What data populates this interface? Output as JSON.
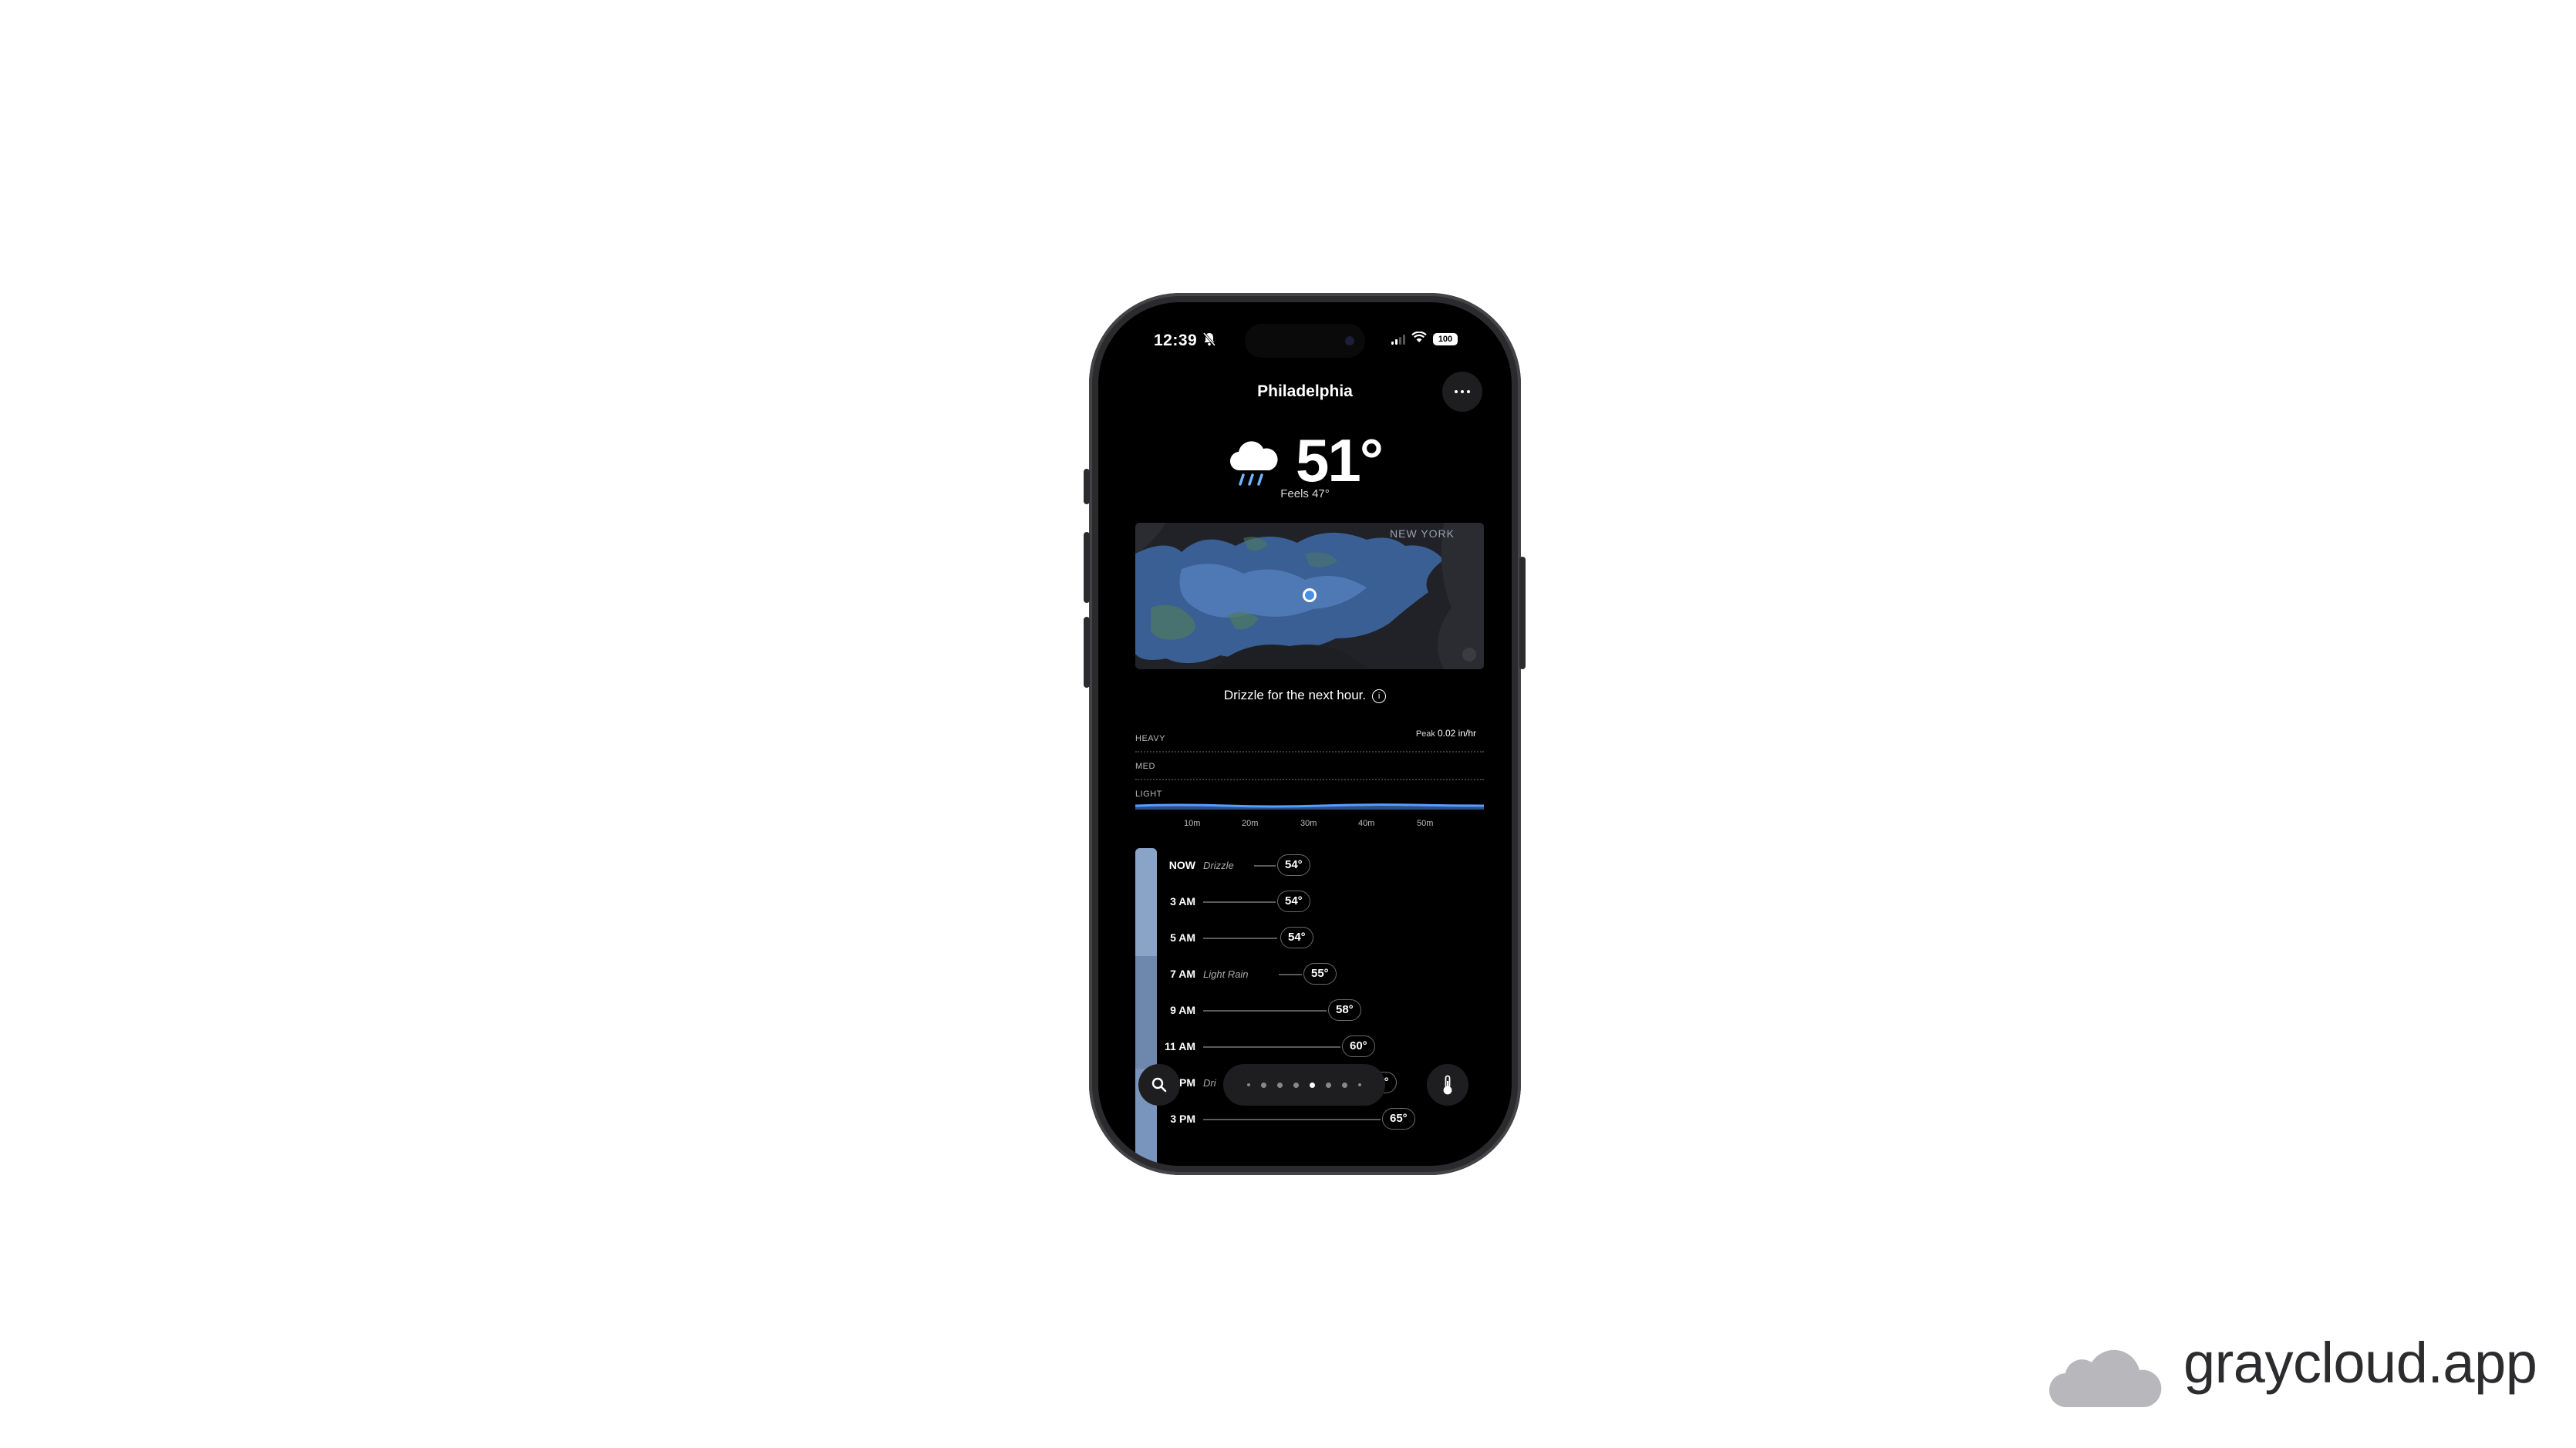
{
  "status_bar": {
    "time": "12:39",
    "battery": "100"
  },
  "header": {
    "city": "Philadelphia"
  },
  "current": {
    "temperature": "51°",
    "feels_like": "Feels 47°",
    "condition_icon": "cloud-rain-icon"
  },
  "map": {
    "label": "NEW YORK"
  },
  "precipitation": {
    "summary": "Drizzle for the next hour.",
    "peak_label": "Peak",
    "peak_value": "0.02 in/hr",
    "levels": [
      "HEAVY",
      "MED",
      "LIGHT"
    ],
    "minute_ticks": [
      "10m",
      "20m",
      "30m",
      "40m",
      "50m"
    ],
    "intensity_level": "light"
  },
  "hourly": [
    {
      "time": "NOW",
      "condition": "Drizzle",
      "temp": "54°"
    },
    {
      "time": "3 AM",
      "condition": "",
      "temp": "54°"
    },
    {
      "time": "5 AM",
      "condition": "",
      "temp": "54°"
    },
    {
      "time": "7 AM",
      "condition": "Light Rain",
      "temp": "55°"
    },
    {
      "time": "9 AM",
      "condition": "",
      "temp": "58°"
    },
    {
      "time": "11 AM",
      "condition": "",
      "temp": "60°"
    },
    {
      "time": "1 PM",
      "condition": "Dri",
      "temp": "63°"
    },
    {
      "time": "3 PM",
      "condition": "",
      "temp": "65°"
    }
  ],
  "page_indicator": {
    "count": 7,
    "active_index": 3
  },
  "colors": {
    "precip_bar": "#6d87ad",
    "radar": "#3f6aa8",
    "location_dot": "#4a90e2"
  },
  "brand": {
    "name": "graycloud.app"
  }
}
